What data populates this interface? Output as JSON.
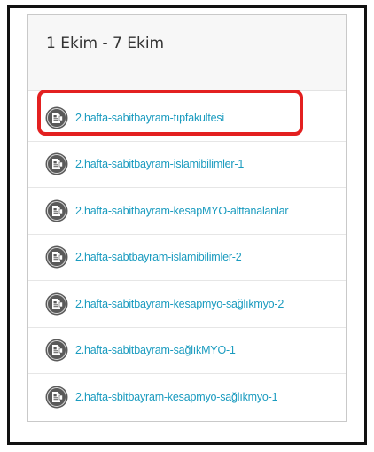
{
  "section": {
    "title": "1 Ekim - 7 Ekim"
  },
  "items": [
    {
      "label": "2.hafta-sabitbayram-tıpfakultesi",
      "icon": "video-file-icon"
    },
    {
      "label": "2.hafta-sabitbayram-islamibilimler-1",
      "icon": "video-file-icon"
    },
    {
      "label": "2.hafta-sabitbayram-kesapMYO-alttanalanlar",
      "icon": "video-file-icon"
    },
    {
      "label": "2.hafta-sabtbayram-islamibilimler-2",
      "icon": "video-file-icon"
    },
    {
      "label": "2.hafta-sabitbayram-kesapmyo-sağlıkmyo-2",
      "icon": "video-file-icon"
    },
    {
      "label": "2.hafta-sabitbayram-sağlıkMYO-1",
      "icon": "video-file-icon"
    },
    {
      "label": "2.hafta-sbitbayram-kesapmyo-sağlıkmyo-1",
      "icon": "video-file-icon"
    }
  ],
  "colors": {
    "link": "#1a9bbf",
    "highlight": "#e32020",
    "icon": "#555555"
  }
}
